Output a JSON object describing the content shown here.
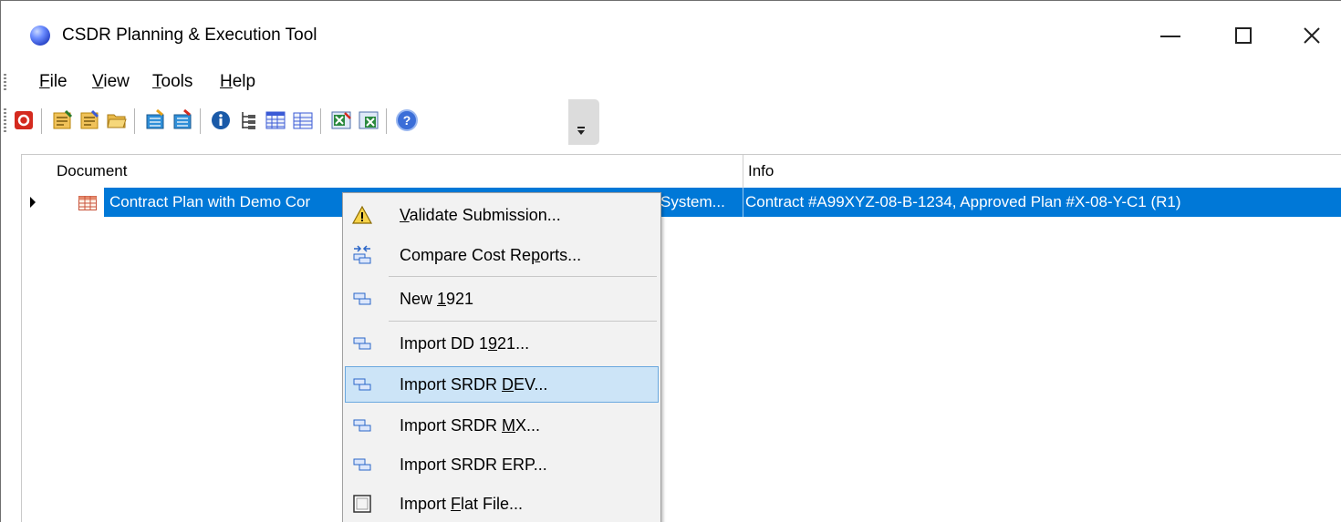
{
  "window": {
    "title": "CSDR Planning & Execution Tool",
    "controls": [
      "minimize",
      "maximize",
      "close"
    ]
  },
  "menubar": {
    "items": [
      {
        "pre": "",
        "key": "F",
        "post": "ile"
      },
      {
        "pre": "",
        "key": "V",
        "post": "iew"
      },
      {
        "pre": "",
        "key": "T",
        "post": "ools"
      },
      {
        "pre": "",
        "key": "H",
        "post": "elp"
      }
    ]
  },
  "toolbar": {
    "buttons": [
      "stop-icon",
      "new-plan-icon",
      "new-plan-alt-icon",
      "open-folder-icon",
      "import-icon",
      "export-icon",
      "info-icon",
      "tree-icon",
      "grid-view-icon",
      "table-view-icon",
      "excel-import-icon",
      "excel-export-icon",
      "help-icon"
    ]
  },
  "grid": {
    "columns": [
      "Document",
      "Info"
    ],
    "rows": [
      {
        "document_left": "Contract Plan with Demo Cor",
        "document_right": "System...",
        "info": "Contract #A99XYZ-08-B-1234, Approved Plan #X-08-Y-C1 (R1)"
      }
    ]
  },
  "context_menu": {
    "items": [
      {
        "pre": "",
        "key": "V",
        "post": "alidate Submission...",
        "icon": "warning-icon"
      },
      {
        "pre": "Compare Cost Re",
        "key": "p",
        "post": "orts...",
        "icon": "compare-icon"
      },
      {
        "pre": "New ",
        "key": "1",
        "post": "921",
        "icon": "form-icon"
      },
      {
        "pre": "Import DD 1",
        "key": "9",
        "post": "21...",
        "icon": "form-icon"
      },
      {
        "pre": "Import SRDR ",
        "key": "D",
        "post": "EV...",
        "icon": "form-icon"
      },
      {
        "pre": "Import SRDR ",
        "key": "M",
        "post": "X...",
        "icon": "form-icon"
      },
      {
        "pre": "Import SRDR ERP...",
        "key": "",
        "post": "",
        "icon": "form-icon"
      },
      {
        "pre": "Import ",
        "key": "F",
        "post": "lat File...",
        "icon": "flat-file-icon"
      }
    ],
    "highlighted_index": 4
  },
  "colors": {
    "selection": "#0078d7",
    "menu_highlight": "#cce4f7",
    "menu_highlight_border": "#6aa8df"
  }
}
